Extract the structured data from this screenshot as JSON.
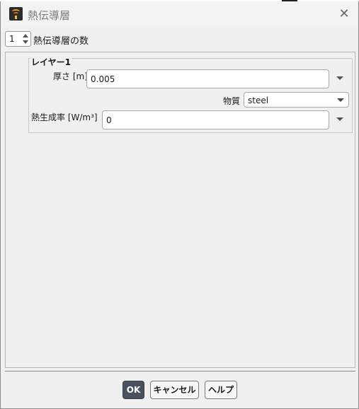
{
  "window": {
    "title": "熱伝導層",
    "close_icon": "close-icon"
  },
  "count": {
    "value": "1",
    "label": "熱伝導層の数"
  },
  "layer": {
    "title": "レイヤー1",
    "thickness_label": "厚さ [m]",
    "thickness_value": "0.005",
    "material_label": "物質",
    "material_value": "steel",
    "heat_label": "熱生成率 [W/m³]",
    "heat_value": "0"
  },
  "buttons": {
    "ok": "OK",
    "cancel": "キャンセル",
    "help": "ヘルプ"
  },
  "colors": {
    "primary_button": "#4a5260",
    "title_text": "#7a7a7a"
  }
}
